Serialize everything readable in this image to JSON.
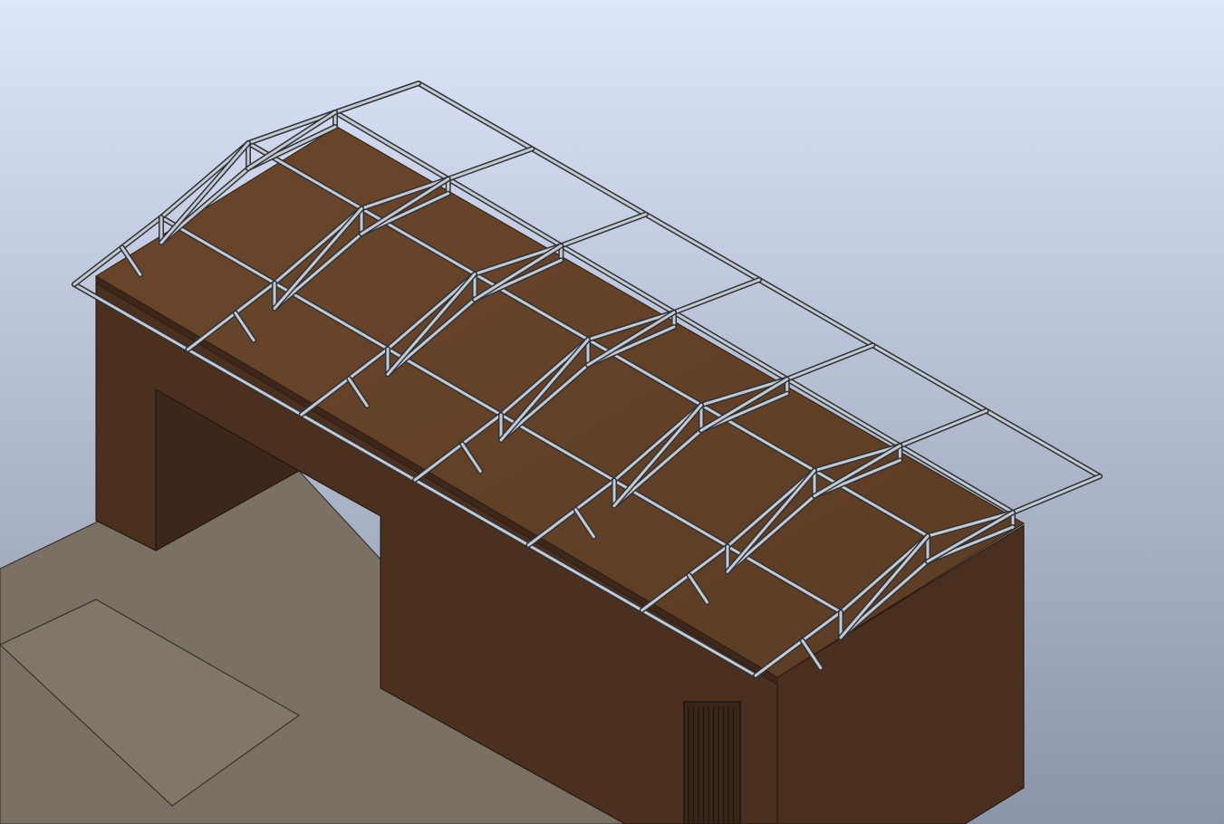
{
  "viewport": {
    "background_top": "#dde6fb",
    "background_bottom": "#8c95a8"
  },
  "building": {
    "wall_front": "#4b2f1f",
    "wall_side": "#4a2f1f",
    "wall_shadow": "#3d271a",
    "wall_edge": "#1d130c",
    "roof_panel": "#613f26",
    "roof_edge": "#2a1b10"
  },
  "ground": {
    "color": "#7a7063",
    "ramp_color": "#817767",
    "edge": "#2b2722"
  },
  "frame": {
    "stroke_light": "#c4c8cf",
    "stroke_dark": "#2f323a"
  },
  "door": {
    "fill": "#3a2619",
    "grill": "#1c1410"
  }
}
